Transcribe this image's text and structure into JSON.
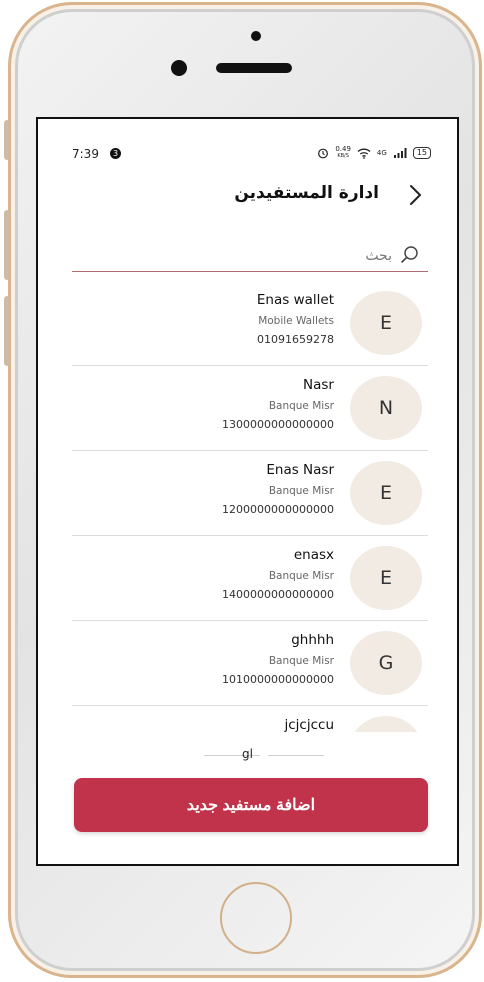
{
  "status_bar": {
    "time": "7:39",
    "notification_count": "3",
    "net_speed_value": "0.49",
    "net_speed_unit": "KB/S",
    "signal_label": "4G",
    "battery": "15"
  },
  "header": {
    "title": "ادارة المستفيدين"
  },
  "search": {
    "placeholder": "بحث"
  },
  "beneficiaries": [
    {
      "initial": "E",
      "name": "Enas wallet",
      "bank": "Mobile Wallets",
      "account": "01091659278"
    },
    {
      "initial": "N",
      "name": "Nasr",
      "bank": "Banque Misr",
      "account": "1300000000000000"
    },
    {
      "initial": "E",
      "name": "Enas Nasr",
      "bank": "Banque Misr",
      "account": "1200000000000000"
    },
    {
      "initial": "E",
      "name": "enasx",
      "bank": "Banque Misr",
      "account": "1400000000000000"
    },
    {
      "initial": "G",
      "name": "ghhhh",
      "bank": "Banque Misr",
      "account": "1010000000000000"
    },
    {
      "initial": "",
      "name": "jcjcjccu",
      "bank": "",
      "account": ""
    }
  ],
  "divider_label": "gl",
  "actions": {
    "add_label": "اضافة مستفيد جديد"
  },
  "icons": {
    "back": "chevron-right-icon",
    "search": "search-icon",
    "alarm": "alarm-icon",
    "wifi": "wifi-icon",
    "signal": "signal-icon",
    "battery": "battery-icon"
  },
  "colors": {
    "accent": "#c0334a",
    "avatar_bg": "#f2ebe3",
    "search_underline": "#b56a72",
    "phone_frame": "#d9b48c"
  }
}
